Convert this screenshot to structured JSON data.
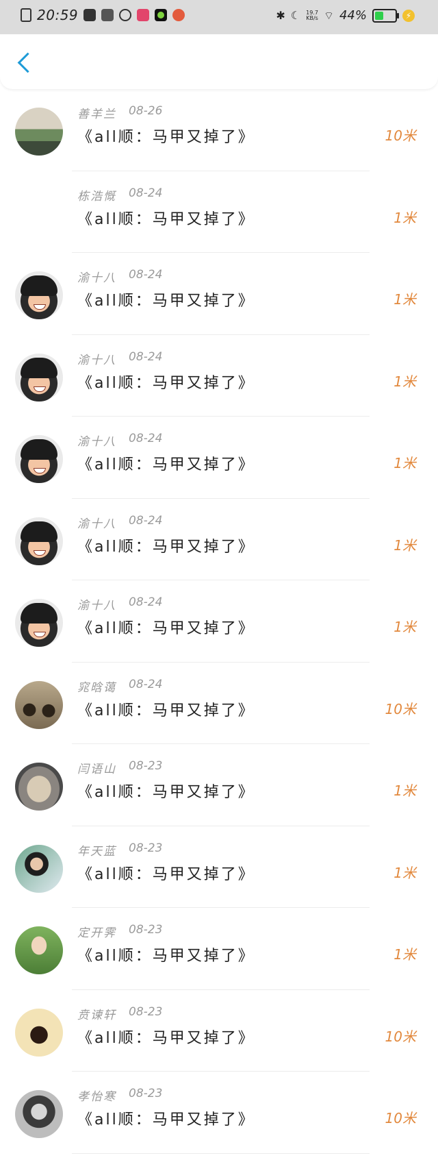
{
  "status_bar": {
    "time": "20:59",
    "net_speed_value": "19.7",
    "net_speed_unit": "KB/s",
    "battery_text": "44%",
    "battery_level": 0.44,
    "battery_color": "#2fcf4b",
    "icons": [
      "sim-icon",
      "video-icon",
      "book-icon",
      "search-app-icon",
      "red-app-icon",
      "green-dot-app-icon",
      "orange-app-icon",
      "bluetooth-icon",
      "moon-icon",
      "wifi-icon",
      "battery-icon",
      "charging-icon"
    ]
  },
  "nav": {
    "back_icon": "chevron-left-icon",
    "accent_color": "#1e9bd7"
  },
  "list": {
    "amount_color": "#e2893e",
    "items": [
      {
        "name": "善羊兰",
        "date": "08-26",
        "title": "《all顺：马甲又掉了》",
        "amount": "10米",
        "avatar": "landscape-avatar"
      },
      {
        "name": "栋浩慨",
        "date": "08-24",
        "title": "《all顺：马甲又掉了》",
        "amount": "1米",
        "avatar": "none"
      },
      {
        "name": "渝十八",
        "date": "08-24",
        "title": "《all顺：马甲又掉了》",
        "amount": "1米",
        "avatar": "face-avatar"
      },
      {
        "name": "渝十八",
        "date": "08-24",
        "title": "《all顺：马甲又掉了》",
        "amount": "1米",
        "avatar": "face-avatar"
      },
      {
        "name": "渝十八",
        "date": "08-24",
        "title": "《all顺：马甲又掉了》",
        "amount": "1米",
        "avatar": "face-avatar"
      },
      {
        "name": "渝十八",
        "date": "08-24",
        "title": "《all顺：马甲又掉了》",
        "amount": "1米",
        "avatar": "face-avatar"
      },
      {
        "name": "渝十八",
        "date": "08-24",
        "title": "《all顺：马甲又掉了》",
        "amount": "1米",
        "avatar": "face-avatar"
      },
      {
        "name": "窕晗蔼",
        "date": "08-24",
        "title": "《all顺：马甲又掉了》",
        "amount": "10米",
        "avatar": "car-avatar"
      },
      {
        "name": "闫语山",
        "date": "08-23",
        "title": "《all顺：马甲又掉了》",
        "amount": "1米",
        "avatar": "cat-avatar"
      },
      {
        "name": "年天蓝",
        "date": "08-23",
        "title": "《all顺：马甲又掉了》",
        "amount": "1米",
        "avatar": "girl-avatar"
      },
      {
        "name": "定开霁",
        "date": "08-23",
        "title": "《all顺：马甲又掉了》",
        "amount": "1米",
        "avatar": "hand-avatar"
      },
      {
        "name": "贲谏轩",
        "date": "08-23",
        "title": "《all顺：马甲又掉了》",
        "amount": "10米",
        "avatar": "cartoon-avatar"
      },
      {
        "name": "孝怡寒",
        "date": "08-23",
        "title": "《all顺：马甲又掉了》",
        "amount": "10米",
        "avatar": "bw-avatar"
      }
    ]
  }
}
